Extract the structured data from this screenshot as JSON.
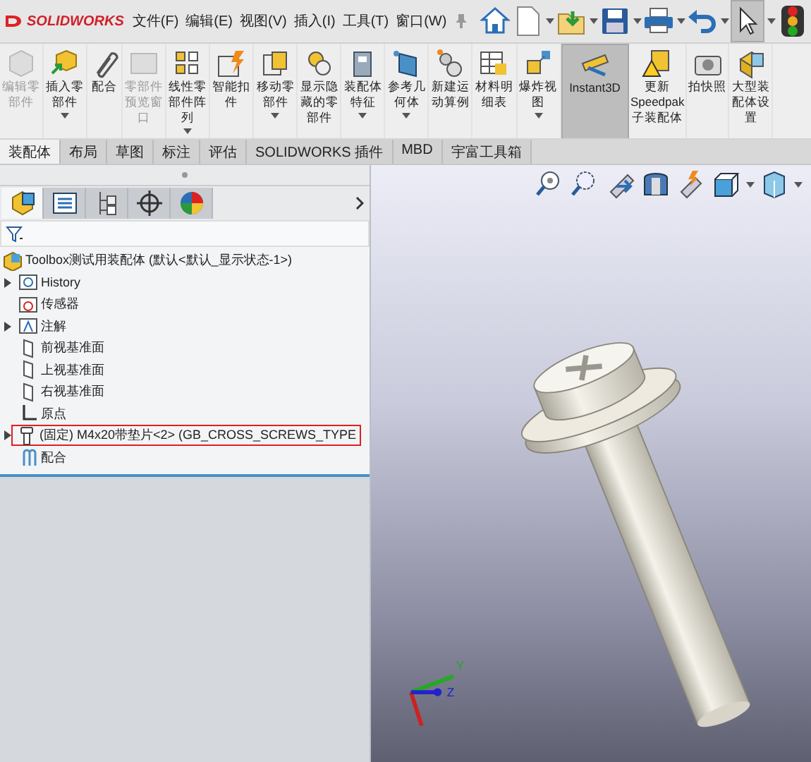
{
  "app": {
    "logo": "SOLIDWORKS"
  },
  "menu": [
    "文件(F)",
    "编辑(E)",
    "视图(V)",
    "插入(I)",
    "工具(T)",
    "窗口(W)"
  ],
  "quick_toolbar": [
    {
      "kind": "home",
      "dropdown": false,
      "selected": false
    },
    {
      "kind": "new",
      "dropdown": true,
      "selected": false
    },
    {
      "kind": "open",
      "dropdown": true,
      "selected": false
    },
    {
      "kind": "save",
      "dropdown": true,
      "selected": false
    },
    {
      "kind": "print",
      "dropdown": true,
      "selected": false
    },
    {
      "kind": "undo",
      "dropdown": true,
      "selected": false
    },
    {
      "kind": "select",
      "dropdown": true,
      "selected": true
    },
    {
      "kind": "light",
      "dropdown": false,
      "selected": false
    }
  ],
  "ribbon": [
    {
      "label": "编辑零部件",
      "kind": "edit",
      "disabled": true,
      "dropdown": false,
      "selected": false
    },
    {
      "label": "插入零部件",
      "kind": "insert",
      "disabled": false,
      "dropdown": true,
      "selected": false
    },
    {
      "label": "配合",
      "kind": "mate",
      "disabled": false,
      "dropdown": false,
      "selected": false
    },
    {
      "label": "零部件预览窗口",
      "kind": "preview",
      "disabled": true,
      "dropdown": false,
      "selected": false
    },
    {
      "label": "线性零部件阵列",
      "kind": "pattern",
      "disabled": false,
      "dropdown": true,
      "selected": false
    },
    {
      "label": "智能扣件",
      "kind": "fastener",
      "disabled": false,
      "dropdown": false,
      "selected": false
    },
    {
      "label": "移动零部件",
      "kind": "move",
      "disabled": false,
      "dropdown": true,
      "selected": false
    },
    {
      "label": "显示隐藏的零部件",
      "kind": "show",
      "disabled": false,
      "dropdown": false,
      "selected": false
    },
    {
      "label": "装配体特征",
      "kind": "feature",
      "disabled": false,
      "dropdown": true,
      "selected": false
    },
    {
      "label": "参考几何体",
      "kind": "reference",
      "disabled": false,
      "dropdown": true,
      "selected": false
    },
    {
      "label": "新建运动算例",
      "kind": "motion",
      "disabled": false,
      "dropdown": false,
      "selected": false
    },
    {
      "label": "材料明细表",
      "kind": "bom",
      "disabled": false,
      "dropdown": false,
      "selected": false
    },
    {
      "label": "爆炸视图",
      "kind": "explode",
      "disabled": false,
      "dropdown": true,
      "selected": false
    },
    {
      "label": "Instant3D",
      "kind": "instant",
      "disabled": false,
      "dropdown": false,
      "selected": true
    },
    {
      "label": "更新 Speedpak 子装配体",
      "kind": "speedpak",
      "disabled": false,
      "dropdown": false,
      "selected": false
    },
    {
      "label": "拍快照",
      "kind": "camera",
      "disabled": false,
      "dropdown": false,
      "selected": false
    },
    {
      "label": "大型装配体设置",
      "kind": "large",
      "disabled": false,
      "dropdown": false,
      "selected": false
    }
  ],
  "tabs": [
    {
      "label": "装配体",
      "selected": true
    },
    {
      "label": "布局",
      "selected": false
    },
    {
      "label": "草图",
      "selected": false
    },
    {
      "label": "标注",
      "selected": false
    },
    {
      "label": "评估",
      "selected": false
    },
    {
      "label": "SOLIDWORKS 插件",
      "selected": false
    },
    {
      "label": "MBD",
      "selected": false
    },
    {
      "label": "宇富工具箱",
      "selected": false
    }
  ],
  "view_toolbar": [
    {
      "kind": "zoom-fit",
      "dropdown": false
    },
    {
      "kind": "zoom-area",
      "dropdown": false
    },
    {
      "kind": "previous",
      "dropdown": false
    },
    {
      "kind": "section",
      "dropdown": false
    },
    {
      "kind": "dynamic",
      "dropdown": false
    },
    {
      "kind": "orientation",
      "dropdown": true
    },
    {
      "kind": "display",
      "dropdown": true
    }
  ],
  "panel_tabs": [
    {
      "kind": "feature",
      "selected": true
    },
    {
      "kind": "property",
      "selected": false
    },
    {
      "kind": "config",
      "selected": false
    },
    {
      "kind": "dimxpert",
      "selected": false
    },
    {
      "kind": "appearance",
      "selected": false
    }
  ],
  "tree": {
    "label": "Toolbox测试用装配体 (默认<默认_显示状态-1>)",
    "kind": "assembly",
    "children": [
      {
        "label": "History",
        "kind": "history",
        "expandable": true,
        "boxed": false
      },
      {
        "label": "传感器",
        "kind": "sensor",
        "expandable": false,
        "boxed": false
      },
      {
        "label": "注解",
        "kind": "annotation",
        "expandable": true,
        "boxed": false
      },
      {
        "label": "前视基准面",
        "kind": "plane",
        "expandable": false,
        "boxed": false
      },
      {
        "label": "上视基准面",
        "kind": "plane",
        "expandable": false,
        "boxed": false
      },
      {
        "label": "右视基准面",
        "kind": "plane",
        "expandable": false,
        "boxed": false
      },
      {
        "label": "原点",
        "kind": "origin",
        "expandable": false,
        "boxed": false
      },
      {
        "label": "(固定) M4x20带垫片<2> (GB_CROSS_SCREWS_TYPE",
        "kind": "part",
        "expandable": true,
        "boxed": true
      },
      {
        "label": "配合",
        "kind": "mates",
        "expandable": false,
        "boxed": false
      }
    ]
  },
  "triad": {
    "labels": [
      "Y",
      "Z"
    ]
  }
}
